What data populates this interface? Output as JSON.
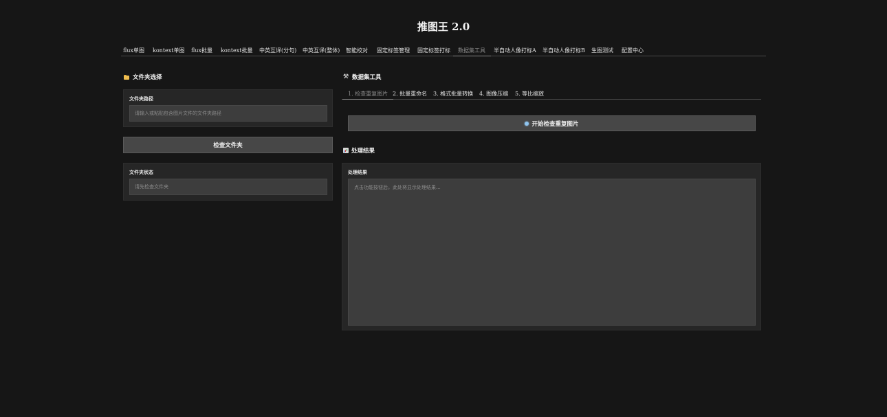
{
  "app": {
    "title": "推图王 2.0"
  },
  "nav": {
    "tabs": [
      {
        "label": "flux单图"
      },
      {
        "label": "kontext单图"
      },
      {
        "label": "flux批量"
      },
      {
        "label": "kontext批量"
      },
      {
        "label": "中英互译(分句)"
      },
      {
        "label": "中英互译(整体)"
      },
      {
        "label": "智能校对"
      },
      {
        "label": "固定标签管理"
      },
      {
        "label": "固定标签打标"
      },
      {
        "label": "数据集工具"
      },
      {
        "label": "半自动人像打标A"
      },
      {
        "label": "半自动人像打标B"
      },
      {
        "label": "生图测试"
      },
      {
        "label": "配置中心"
      }
    ],
    "active_index": 9
  },
  "left": {
    "heading": "文件夹选择",
    "heading_icon": "folder-icon",
    "path_label": "文件夹路径",
    "path_placeholder": "请输入或粘贴包含图片文件的文件夹路径",
    "check_button": "检查文件夹",
    "status_label": "文件夹状态",
    "status_placeholder": "请先检查文件夹"
  },
  "right": {
    "heading": "数据集工具",
    "heading_icon": "tools-icon",
    "subtabs": [
      {
        "label": "1. 检查重复图片"
      },
      {
        "label": "2. 批量重命名"
      },
      {
        "label": "3. 格式批量转换"
      },
      {
        "label": "4. 图像压缩"
      },
      {
        "label": "5. 等比缩放"
      }
    ],
    "active_subtab": 0,
    "start_button": "开始检查重复图片",
    "start_button_icon": "bulb-icon",
    "results_heading": "处理结果",
    "results_heading_icon": "chart-icon",
    "results_label": "处理结果",
    "results_placeholder": "点击功能按钮后，此处将显示处理结果..."
  },
  "colors": {
    "background": "#161616",
    "panel": "#262626",
    "input": "#3d3d3d",
    "button": "#474747",
    "folder_accent": "#f0bd4f"
  }
}
